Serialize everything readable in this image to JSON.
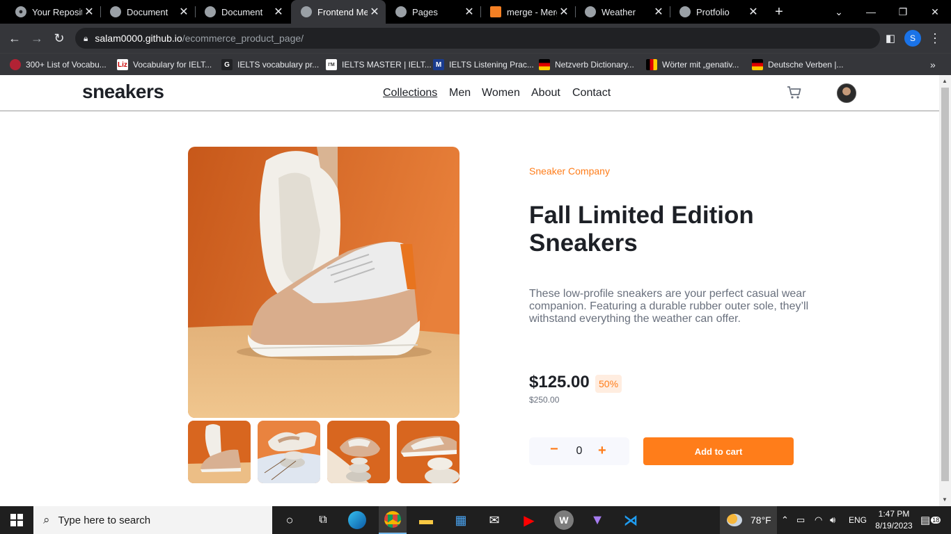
{
  "browser": {
    "tabs": [
      {
        "title": "Your Reposito",
        "icon": "github-icon"
      },
      {
        "title": "Document",
        "icon": "globe-icon"
      },
      {
        "title": "Document",
        "icon": "globe-icon"
      },
      {
        "title": "Frontend Men",
        "icon": "globe-icon",
        "active": true
      },
      {
        "title": "Pages",
        "icon": "github-icon"
      },
      {
        "title": "merge - Merg",
        "icon": "stackoverflow-icon"
      },
      {
        "title": "Weather",
        "icon": "globe-icon"
      },
      {
        "title": "Protfolio",
        "icon": "globe-icon"
      }
    ],
    "url_host": "salam0000.github.io",
    "url_path": "/ecommerce_product_page/",
    "profile_initial": "S",
    "bookmarks": [
      {
        "label": "300+ List of Vocabu...",
        "icon_text": ""
      },
      {
        "label": "Vocabulary for IELT...",
        "icon_text": "Liz"
      },
      {
        "label": "IELTS vocabulary pr...",
        "icon_text": "G"
      },
      {
        "label": "IELTS MASTER | IELT...",
        "icon_text": "I'M"
      },
      {
        "label": "IELTS Listening Prac...",
        "icon_text": ""
      },
      {
        "label": "Netzverb Dictionary...",
        "icon_text": ""
      },
      {
        "label": "Wörter mit „genativ...",
        "icon_text": ""
      },
      {
        "label": "Deutsche Verben |...",
        "icon_text": ""
      }
    ]
  },
  "site": {
    "logo": "sneakers",
    "nav": [
      "Collections",
      "Men",
      "Women",
      "About",
      "Contact"
    ]
  },
  "product": {
    "company": "Sneaker Company",
    "title": "Fall Limited Edition Sneakers",
    "description": "These low-profile sneakers are your perfect casual wear companion. Featuring a durable rubber outer sole, they’ll withstand everything the weather can offer.",
    "price": "$125.00",
    "discount": "50%",
    "old_price": "$250.00",
    "quantity": "0",
    "add_to_cart": "Add to cart"
  },
  "taskbar": {
    "search_placeholder": "Type here to search",
    "temperature": "78°F",
    "language": "ENG",
    "time": "1:47 PM",
    "date": "8/19/2023",
    "notifications": "18"
  },
  "colors": {
    "accent": "#ff7d1a",
    "accent_pale": "#ffede0",
    "text_dark": "#1d2026",
    "text_gray": "#69707d"
  }
}
